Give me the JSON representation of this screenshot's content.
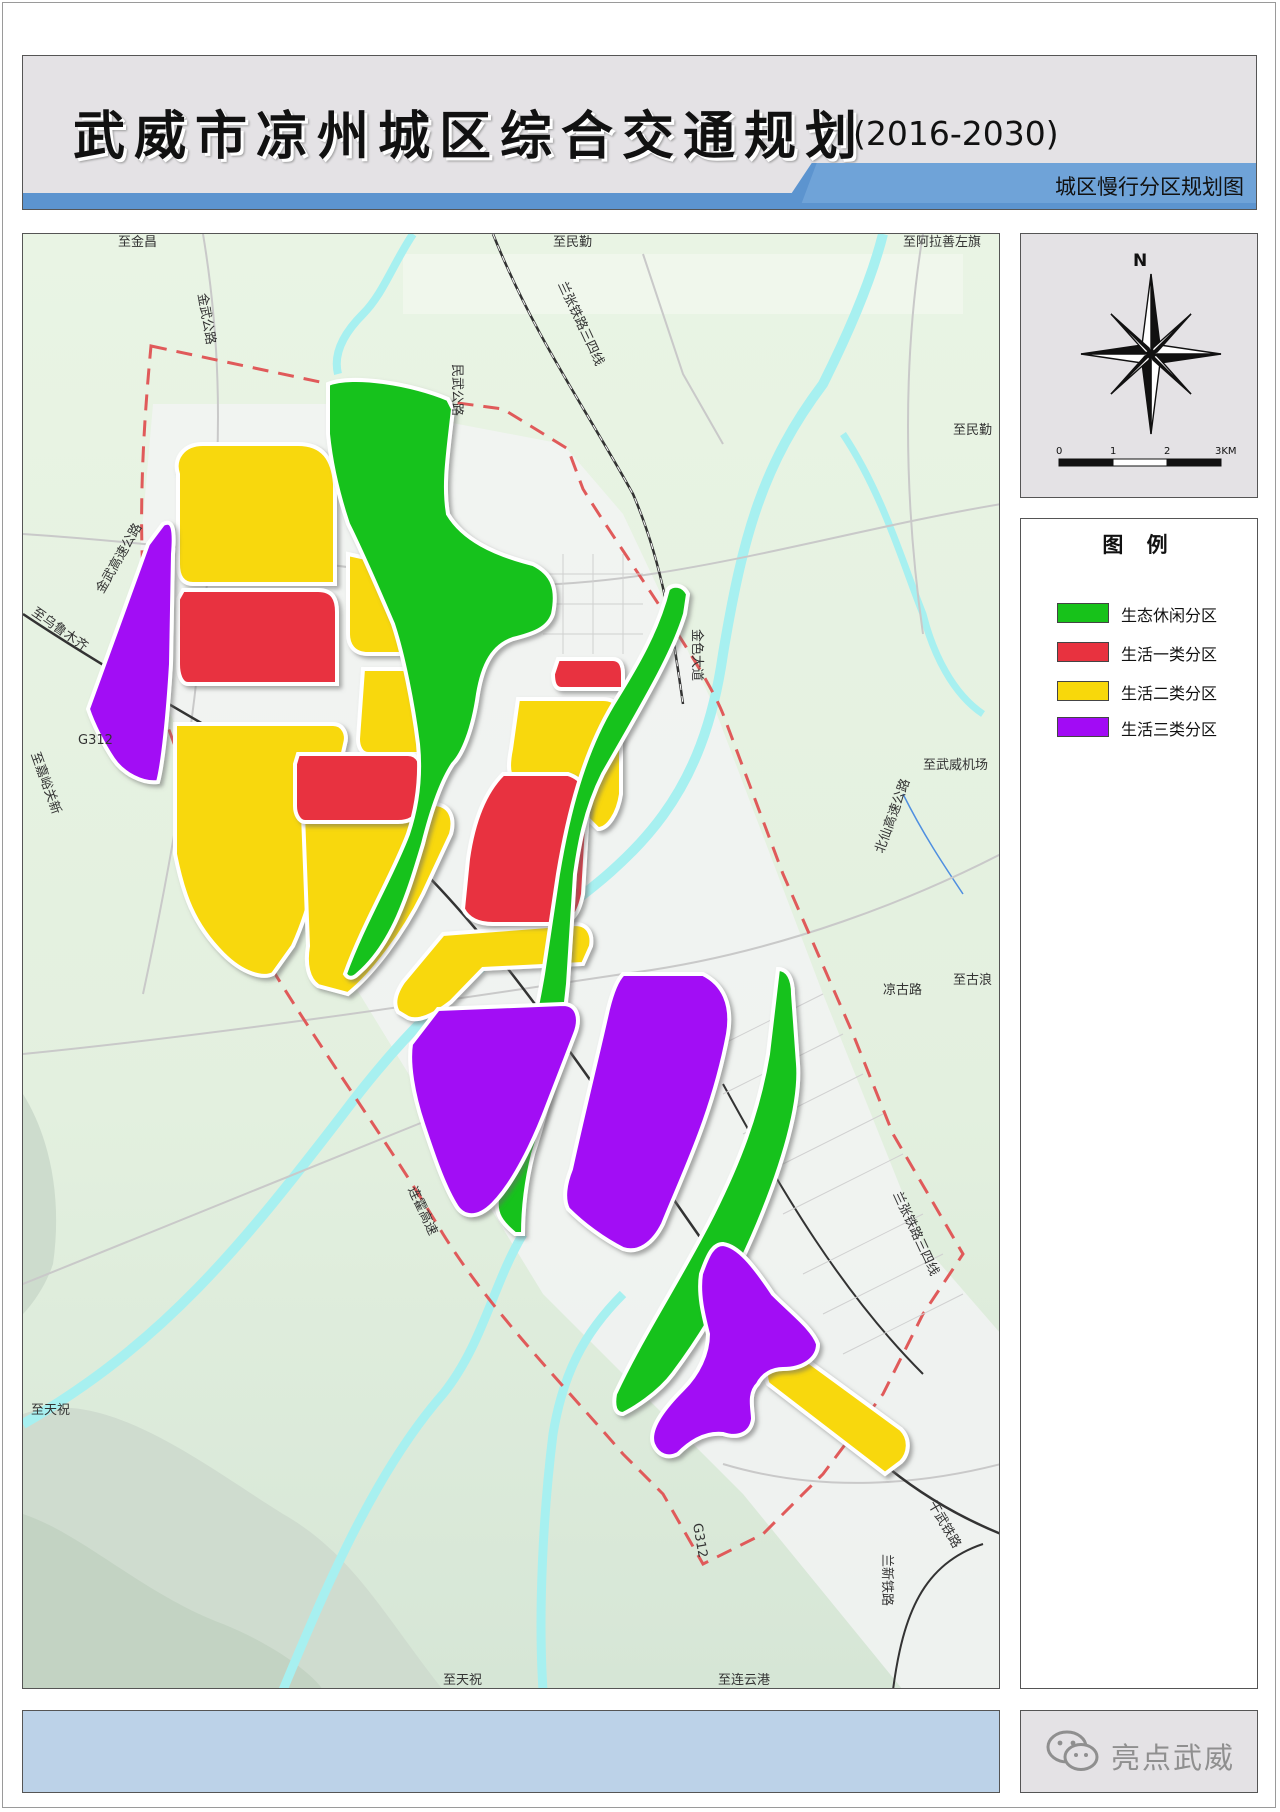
{
  "header": {
    "title": "武威市凉州城区综合交通规划",
    "years": "(2016-2030)",
    "subtitle": "城区慢行分区规划图",
    "band_color": "#5c94cf"
  },
  "compass": {
    "north": "N",
    "scale_labels": [
      "0",
      "1",
      "2",
      "3KM"
    ]
  },
  "legend": {
    "title": "图 例",
    "items": [
      {
        "label": "生态休闲分区",
        "color": "#17c21a"
      },
      {
        "label": "生活一类分区",
        "color": "#e8323f"
      },
      {
        "label": "生活二类分区",
        "color": "#f8d80b"
      },
      {
        "label": "生活三类分区",
        "color": "#a20bf5"
      }
    ]
  },
  "map_labels": {
    "to_jinchang": "至金昌",
    "to_minqin_top": "至民勤",
    "to_alxa": "至阿拉善左旗",
    "to_minqin_right": "至民勤",
    "jinwu_road": "金武公路",
    "minwu_road": "民武公路",
    "lanzhang_railway": "兰张铁路三四线",
    "jinwu_expressway": "金武高速公路",
    "to_urumqi": "至乌鲁木齐",
    "g312_west": "G312",
    "to_zhangye": "至嘉峪关新",
    "jinse_avenue": "金色大道",
    "to_airport": "至武威机场",
    "beixian_expressway": "北仙高速公路",
    "to_gulang": "至古浪",
    "lianggu_road": "凉古路",
    "lianhuo_expressway": "连霍高速",
    "lanzhang_line_east": "兰张铁路三四线",
    "to_tianzhu_west": "至天祝",
    "gansu_railway": "干武铁路",
    "g312_south": "G312",
    "lanxin_railway": "兰新铁路",
    "to_tianzhu_south": "至天祝",
    "to_lianyungang": "至连云港"
  },
  "colors": {
    "eco": "#17c21a",
    "life1": "#e8323f",
    "life2": "#f8d80b",
    "life3": "#a20bf5",
    "river": "#a7f0f0",
    "boundary": "#e05a5a"
  },
  "watermark": {
    "text": "亮点武威",
    "icon": "wechat-icon"
  }
}
